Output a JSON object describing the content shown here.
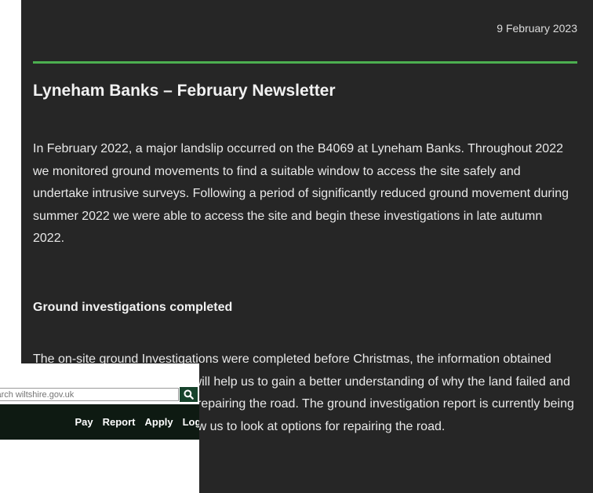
{
  "newsletter": {
    "date": "9 February 2023",
    "title": "Lyneham Banks – February Newsletter",
    "intro": "In February 2022, a major landslip occurred on the B4069 at Lyneham Banks. Throughout 2022 we monitored ground movements to find a suitable window to access the site safely and undertake intrusive surveys. Following a period of significantly reduced ground movement during summer 2022 we were able to access the site and begin these investigations in late autumn 2022.",
    "subheading": "Ground investigations completed",
    "body": "The on-site ground Investigations were completed before Christmas, the information obtained through these investigations will help us to gain a better understanding of why the land failed and to develop design options for repairing the road. The ground investigation report is currently being prepared. This will clearly allow us to look at options for repairing the road.",
    "accent_color": "#4caf50"
  },
  "wiltshire_header": {
    "search": {
      "placeholder": "Search wiltshire.gov.uk",
      "icon": "search-icon"
    },
    "nav": [
      {
        "label": "Pay"
      },
      {
        "label": "Report"
      },
      {
        "label": "Apply"
      },
      {
        "label": "Login"
      }
    ],
    "brand_color": "#17432c"
  }
}
